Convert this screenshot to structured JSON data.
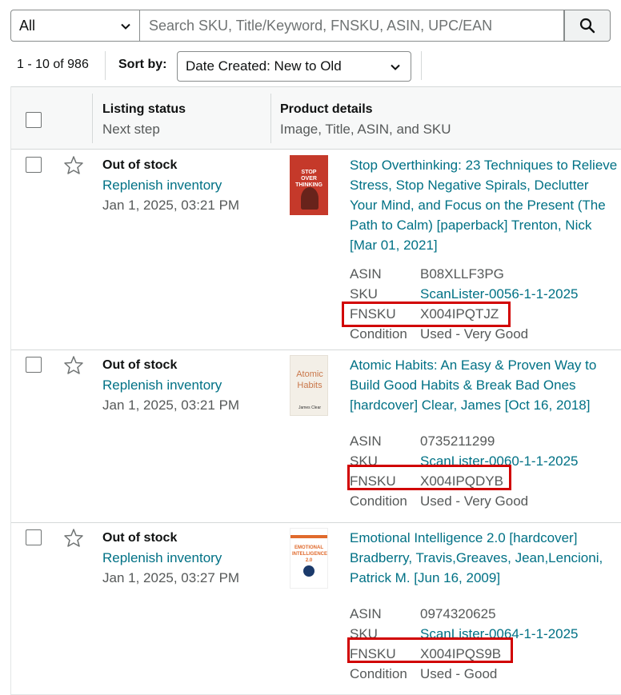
{
  "search": {
    "category": "All",
    "placeholder": "Search SKU, Title/Keyword, FNSKU, ASIN, UPC/EAN",
    "value": ""
  },
  "toolbar": {
    "count": "1 - 10 of 986",
    "sort_label": "Sort by:",
    "sort_value": "Date Created: New to Old"
  },
  "table": {
    "col_status_title": "Listing status",
    "col_status_sub": "Next step",
    "col_product_title": "Product details",
    "col_product_sub": "Image, Title, ASIN, and SKU"
  },
  "labels": {
    "asin": "ASIN",
    "sku": "SKU",
    "fnsku": "FNSKU",
    "condition": "Condition"
  },
  "rows": [
    {
      "status": "Out of stock",
      "next_step": "Replenish inventory",
      "date": "Jan 1, 2025, 03:21 PM",
      "title": "Stop Overthinking: 23 Techniques to Relieve Stress, Stop Negative Spirals, Declutter Your Mind, and Focus on the Present (The Path to Calm) [paperback] Trenton, Nick [Mar 01, 2021]",
      "asin": "B08XLLF3PG",
      "sku": "ScanLister-0056-1-1-2025",
      "fnsku": "X004IPQTJZ",
      "condition": "Used - Very Good",
      "cover_text": "STOP OVER THINKING"
    },
    {
      "status": "Out of stock",
      "next_step": "Replenish inventory",
      "date": "Jan 1, 2025, 03:21 PM",
      "title": "Atomic Habits: An Easy & Proven Way to Build Good Habits & Break Bad Ones [hardcover] Clear, James [Oct 16, 2018]",
      "asin": "0735211299",
      "sku": "ScanLister-0060-1-1-2025",
      "fnsku": "X004IPQDYB",
      "condition": "Used - Very Good",
      "cover_text": "Atomic Habits",
      "cover_author": "James Clear"
    },
    {
      "status": "Out of stock",
      "next_step": "Replenish inventory",
      "date": "Jan 1, 2025, 03:27 PM",
      "title": "Emotional Intelligence 2.0 [hardcover] Bradberry, Travis,Greaves, Jean,Lencioni, Patrick M. [Jun 16, 2009]",
      "asin": "0974320625",
      "sku": "ScanLister-0064-1-1-2025",
      "fnsku": "X004IPQS9B",
      "condition": "Used - Good",
      "cover_text": "EMOTIONAL INTELLIGENCE 2.0"
    }
  ],
  "colors": {
    "link": "#007185",
    "highlight": "#d10000",
    "muted": "#565959"
  }
}
